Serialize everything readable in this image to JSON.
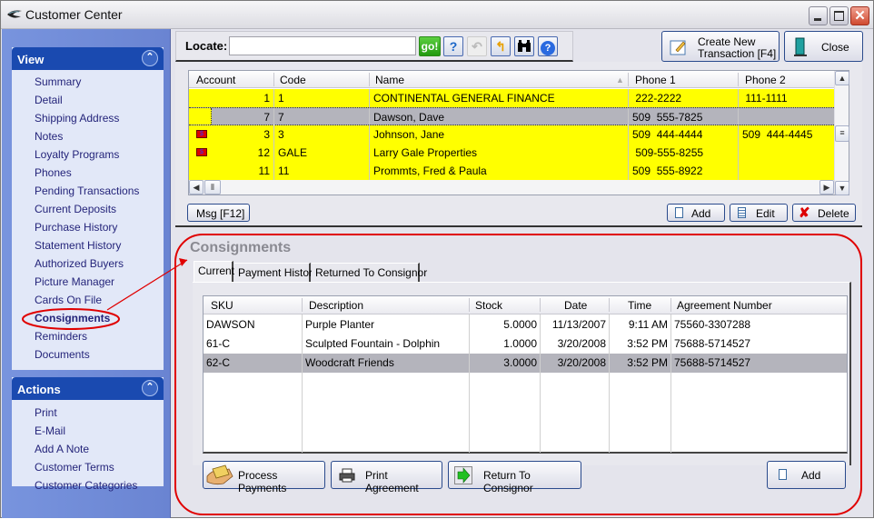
{
  "window": {
    "title": "Customer Center",
    "controls": [
      "minimize",
      "maximize",
      "close"
    ]
  },
  "sidebar": {
    "view": {
      "title": "View",
      "items": [
        {
          "label": "Summary"
        },
        {
          "label": "Detail"
        },
        {
          "label": "Shipping Address"
        },
        {
          "label": "Notes"
        },
        {
          "label": "Loyalty Programs"
        },
        {
          "label": "Phones"
        },
        {
          "label": "Pending Transactions"
        },
        {
          "label": "Current Deposits"
        },
        {
          "label": "Purchase History"
        },
        {
          "label": "Statement History"
        },
        {
          "label": "Authorized Buyers"
        },
        {
          "label": "Picture Manager"
        },
        {
          "label": "Cards On File"
        },
        {
          "label": "Consignments",
          "active": true
        },
        {
          "label": "Reminders"
        },
        {
          "label": "Documents"
        }
      ]
    },
    "actions": {
      "title": "Actions",
      "items": [
        {
          "label": "Print"
        },
        {
          "label": "E-Mail"
        },
        {
          "label": "Add A Note"
        },
        {
          "label": "Customer Terms"
        },
        {
          "label": "Customer Categories"
        }
      ]
    }
  },
  "toolbar": {
    "locate_label": "Locate:",
    "locate_value": "",
    "go_label": "go!",
    "icons": [
      "help-question-icon",
      "undo-arrow-icon",
      "back-arrow-icon",
      "binoculars-icon",
      "info-help-icon"
    ],
    "create_new_line1": "Create New",
    "create_new_line2": "Transaction [F4]",
    "close_label": "Close"
  },
  "customers": {
    "columns": [
      "Account",
      "Code",
      "Name",
      "Phone 1",
      "Phone 2"
    ],
    "sort_indicator": "▲",
    "rows": [
      {
        "flag": false,
        "account": "1",
        "code": "1",
        "name": "CONTINENTAL GENERAL FINANCE",
        "phone1": " 222-2222",
        "phone2": " 111-1111",
        "selected": false
      },
      {
        "flag": false,
        "account": "7",
        "code": "7",
        "name": "Dawson, Dave",
        "phone1": "509  555-7825",
        "phone2": "",
        "selected": true
      },
      {
        "flag": true,
        "account": "3",
        "code": "3",
        "name": "Johnson, Jane",
        "phone1": "509  444-4444",
        "phone2": "509  444-4445",
        "selected": false
      },
      {
        "flag": true,
        "account": "12",
        "code": "GALE",
        "name": "Larry Gale Properties",
        "phone1": " 509-555-8255",
        "phone2": "",
        "selected": false
      },
      {
        "flag": false,
        "account": "11",
        "code": "11",
        "name": "Prommts, Fred & Paula",
        "phone1": "509  555-8922",
        "phone2": "",
        "selected": false
      }
    ],
    "msg_label": "Msg [F12]",
    "add_label": "Add",
    "edit_label": "Edit",
    "delete_label": "Delete"
  },
  "consignments": {
    "title": "Consignments",
    "tabs": [
      {
        "label": "Current",
        "active": true
      },
      {
        "label": "Payment History",
        "active": false
      },
      {
        "label": "Returned To Consignor",
        "active": false
      }
    ],
    "columns": [
      "SKU",
      "Description",
      "Stock",
      "Date",
      "Time",
      "Agreement Number"
    ],
    "rows": [
      {
        "sku": "DAWSON",
        "description": "Purple Planter",
        "stock": "5.0000",
        "date": "11/13/2007",
        "time": "9:11 AM",
        "agreement": "75560-3307288",
        "selected": false
      },
      {
        "sku": "61-C",
        "description": "Sculpted Fountain - Dolphin",
        "stock": "1.0000",
        "date": "3/20/2008",
        "time": "3:52 PM",
        "agreement": "75688-5714527",
        "selected": false
      },
      {
        "sku": "62-C",
        "description": "Woodcraft Friends",
        "stock": "3.0000",
        "date": "3/20/2008",
        "time": "3:52 PM",
        "agreement": "75688-5714527",
        "selected": true
      }
    ],
    "process_payments_label": "Process Payments",
    "print_agreement_label": "Print Agreement",
    "return_label": "Return To Consignor",
    "add_label": "Add"
  },
  "colors": {
    "highlight_row": "#ffff00",
    "selected_row": "#b4b4bc",
    "panel_header": "#1a4ab0",
    "annotation": "#e00000"
  }
}
